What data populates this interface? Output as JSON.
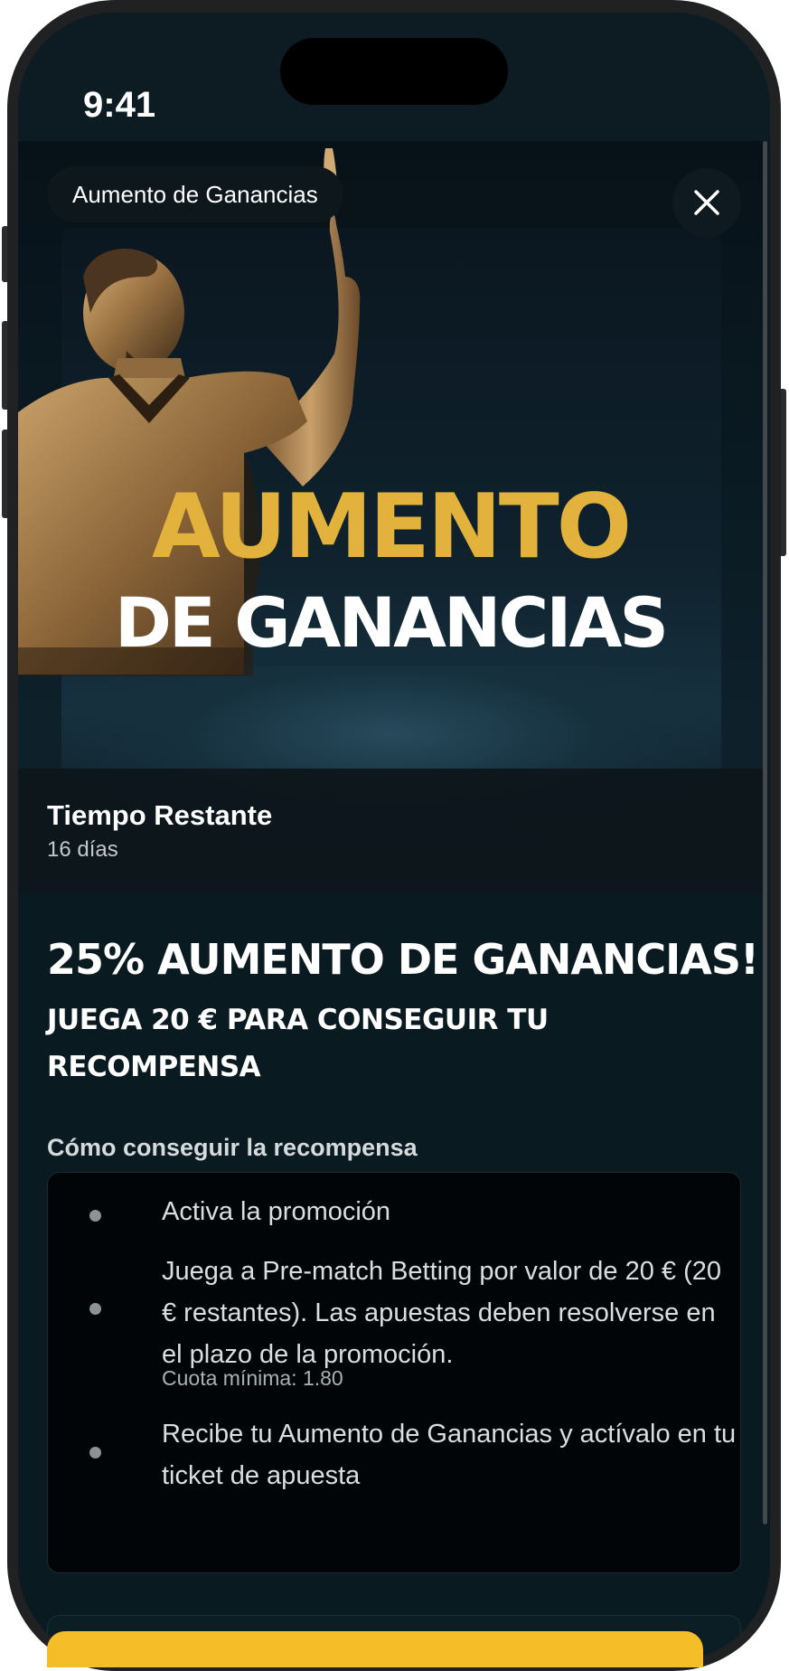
{
  "status_bar": {
    "time": "9:41"
  },
  "promo": {
    "chip_label": "Aumento de Ganancias",
    "hero_title_line1": "AUMENTO",
    "hero_title_line2": "DE GANANCIAS",
    "time_remaining_label": "Tiempo Restante",
    "time_remaining_value": "16 días",
    "headline": "25% AUMENTO DE GANANCIAS!",
    "subheadline": "JUEGA 20 € PARA CONSEGUIR TU RECOMPENSA"
  },
  "how_to": {
    "title": "Cómo conseguir la recompensa",
    "steps": [
      {
        "text": "Activa la promoción"
      },
      {
        "text": "Juega a Pre-match Betting por valor de 20 € (20 € restantes). Las apuestas deben resolverse en el plazo de la promoción.",
        "note": "Cuota mínima: 1.80"
      },
      {
        "text": "Recibe tu Aumento de Ganancias y actívalo en tu ticket de apuesta"
      }
    ]
  },
  "colors": {
    "accent_gold": "#e3b23c",
    "cta_yellow": "#f5bd28",
    "background": "#0a1a21"
  },
  "icons": {
    "close": "close-icon"
  }
}
